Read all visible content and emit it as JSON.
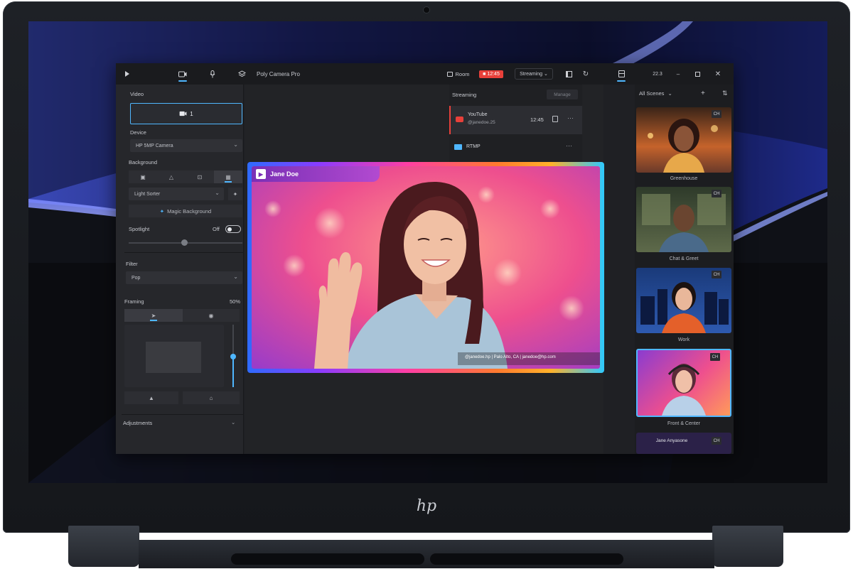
{
  "app": {
    "title": "Poly Camera Pro",
    "room_label": "Room",
    "record_time": "12:45",
    "streaming_label": "Streaming",
    "window_value": "22.3"
  },
  "left_panel": {
    "video_label": "Video",
    "camera_count": "1",
    "device_label": "Device",
    "device_value": "HP 5MP Camera",
    "background_label": "Background",
    "background_value": "Light Sorter",
    "magic_background_label": "Magic Background",
    "spotlight_label": "Spotlight",
    "spotlight_state": "Off",
    "filter_label": "Filter",
    "filter_value": "Pop",
    "framing_label": "Framing",
    "framing_value": "50%",
    "adjustments_label": "Adjustments"
  },
  "streaming": {
    "header": "Streaming",
    "manage_label": "Manage",
    "destinations": [
      {
        "name": "YouTube",
        "account": "@janedoe.25",
        "time": "12:45"
      },
      {
        "name": "RTMP"
      }
    ]
  },
  "preview": {
    "presenter_name": "Jane Doe",
    "lower_third": "@janedoe.hp | Palo Alto, CA | janedoe@hp.com"
  },
  "scenes": {
    "header": "All Scenes",
    "items": [
      {
        "label": "Greenhouse",
        "chip": "CH"
      },
      {
        "label": "Chat & Greet",
        "chip": "CH"
      },
      {
        "label": "Work",
        "chip": "CH"
      },
      {
        "label": "Front & Center",
        "chip": "CH"
      },
      {
        "label": "Jane Anyasone",
        "chip": "CH"
      }
    ],
    "thumb_caption": "Jane Anyasone"
  },
  "device": {
    "brand": "hp"
  },
  "colors": {
    "accent": "#4fb7ff",
    "record_red": "#e8403a",
    "panel": "#26272b"
  }
}
